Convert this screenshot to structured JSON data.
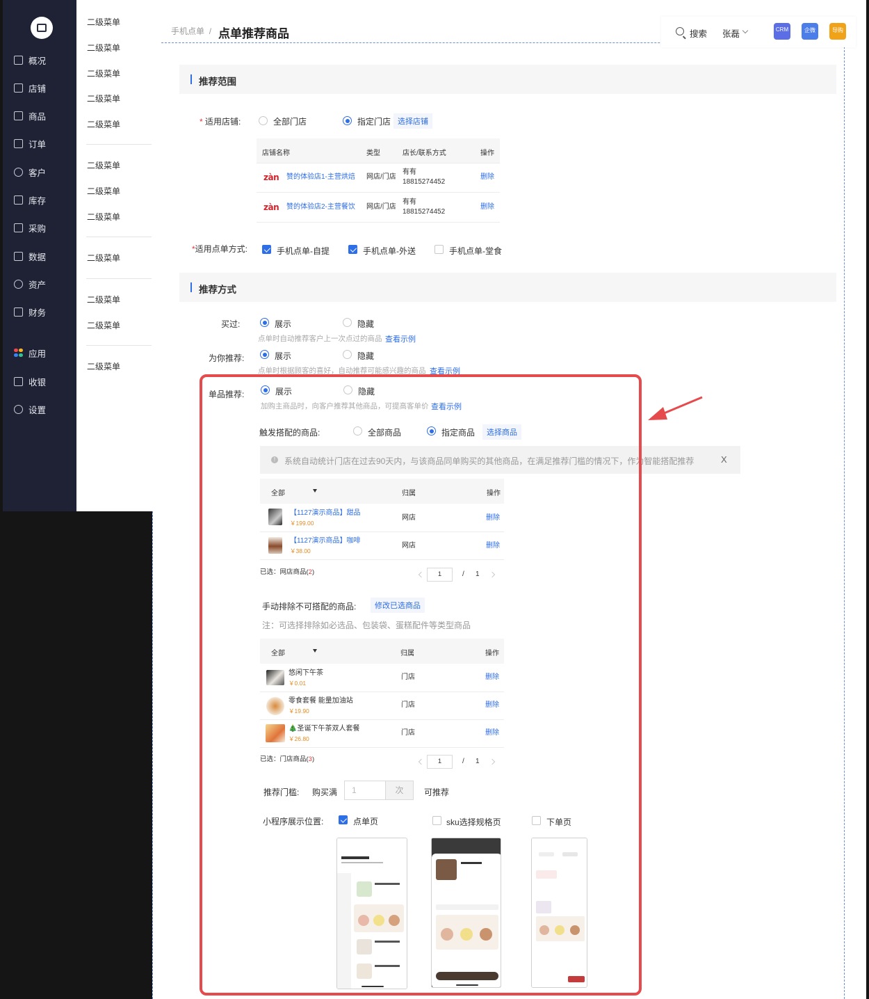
{
  "sidebar": {
    "items": [
      {
        "label": "概况",
        "icon": "overview-icon"
      },
      {
        "label": "店铺",
        "icon": "store-icon"
      },
      {
        "label": "商品",
        "icon": "product-bag-icon"
      },
      {
        "label": "订单",
        "icon": "order-icon"
      },
      {
        "label": "客户",
        "icon": "customer-icon"
      },
      {
        "label": "库存",
        "icon": "inventory-icon"
      },
      {
        "label": "采购",
        "icon": "purchase-icon"
      },
      {
        "label": "数据",
        "icon": "data-chart-icon"
      },
      {
        "label": "资产",
        "icon": "asset-icon"
      },
      {
        "label": "财务",
        "icon": "finance-icon"
      },
      {
        "label": "应用",
        "icon": "apps-icon"
      },
      {
        "label": "收银",
        "icon": "cashier-icon"
      },
      {
        "label": "设置",
        "icon": "settings-gear-icon"
      }
    ]
  },
  "submenu": {
    "items": [
      "二级菜单",
      "二级菜单",
      "二级菜单",
      "二级菜单",
      "二级菜单",
      "二级菜单",
      "二级菜单",
      "二级菜单",
      "二级菜单",
      "二级菜单",
      "二级菜单",
      "二级菜单"
    ]
  },
  "header": {
    "breadcrumb": "手机点单",
    "separator": "/",
    "title": "点单推荐商品",
    "search_label": "搜索",
    "user_name": "张磊",
    "badges": [
      {
        "label": "CRM",
        "color": "#5b6ee6"
      },
      {
        "label": "企微",
        "color": "#4b7ee8"
      },
      {
        "label": "导购",
        "color": "#f0a218"
      }
    ]
  },
  "scope": {
    "section_title": "推荐范围",
    "store_label": "适用店铺:",
    "required_mark": "*",
    "option_all": "全部门店",
    "option_specified": "指定门店",
    "select_store_link": "选择店铺",
    "selected_option": "指定门店",
    "table": {
      "headers": [
        "店铺名称",
        "类型",
        "店长/联系方式",
        "操作"
      ],
      "rows": [
        {
          "brand": "zàn",
          "name": "赞的体验店1-主营烘焙",
          "type": "网店/门店",
          "manager": "有有",
          "phone": "18815274452",
          "action": "删除"
        },
        {
          "brand": "zàn",
          "name": "赞的体验店2-主营餐饮",
          "type": "网店/门店",
          "manager": "有有",
          "phone": "18815274452",
          "action": "删除"
        }
      ]
    },
    "order_method_label": "适用点单方式:",
    "order_methods": [
      {
        "label": "手机点单-自提",
        "checked": true
      },
      {
        "label": "手机点单-外送",
        "checked": true
      },
      {
        "label": "手机点单-堂食",
        "checked": false
      }
    ]
  },
  "method": {
    "section_title": "推荐方式",
    "bought": {
      "label": "买过:",
      "show": "展示",
      "hide": "隐藏",
      "selected": "展示",
      "hint": "点单时自动推荐客户上一次点过的商品",
      "example_link": "查看示例"
    },
    "for_you": {
      "label": "为你推荐:",
      "show": "展示",
      "hide": "隐藏",
      "selected": "展示",
      "hint": "点单时根据顾客的喜好，自动推荐可能感兴趣的商品",
      "example_link": "查看示例"
    },
    "single": {
      "label": "单品推荐:",
      "show": "展示",
      "hide": "隐藏",
      "selected": "展示",
      "hint": "加购主商品时，向客户推荐其他商品，可提高客单价",
      "example_link": "查看示例"
    },
    "trigger": {
      "label": "触发搭配的商品:",
      "option_all": "全部商品",
      "option_specified": "指定商品",
      "selected": "指定商品",
      "select_link": "选择商品",
      "info": "系统自动统计门店在过去90天内，与该商品同单购买的其他商品，在满足推荐门槛的情况下，作为智能搭配推荐",
      "info_close": "X",
      "table": {
        "headers": [
          "全部",
          "归属",
          "操作"
        ],
        "rows": [
          {
            "name": "【1127演示商品】甜品",
            "price": "￥199.00",
            "belong": "网店",
            "action": "删除"
          },
          {
            "name": "【1127演示商品】咖啡",
            "price": "￥38.00",
            "belong": "网店",
            "action": "删除"
          }
        ]
      },
      "selected_summary_prefix": "已选：网店商品(",
      "selected_count": "2",
      "selected_summary_suffix": ")",
      "page": "1",
      "page_sep": "/",
      "page_total": "1"
    },
    "exclude": {
      "label": "手动排除不可搭配的商品:",
      "edit_link": "修改已选商品",
      "note": "注：可选择排除如必选品、包装袋、蛋糕配件等类型商品",
      "table": {
        "headers": [
          "全部",
          "归属",
          "操作"
        ],
        "rows": [
          {
            "name": "悠闲下午茶",
            "price": "￥0.01",
            "belong": "门店",
            "action": "删除"
          },
          {
            "name": "零食套餐 能量加油站",
            "price": "￥19.90",
            "belong": "门店",
            "action": "删除"
          },
          {
            "name": "🎄圣诞下午茶双人套餐",
            "price": "￥26.80",
            "belong": "门店",
            "action": "删除"
          }
        ]
      },
      "selected_summary_prefix": "已选：门店商品(",
      "selected_count": "3",
      "selected_summary_suffix": ")",
      "page": "1",
      "page_sep": "/",
      "page_total": "1"
    },
    "threshold": {
      "label": "推荐门槛:",
      "prefix": "购买满",
      "placeholder": "1",
      "suffix": "次",
      "after": "可推荐"
    },
    "position": {
      "label": "小程序展示位置:",
      "options": [
        {
          "label": "点单页",
          "checked": true
        },
        {
          "label": "sku选择规格页",
          "checked": false
        },
        {
          "label": "下单页",
          "checked": false
        }
      ]
    }
  },
  "colors": {
    "accent": "#2e6ee6",
    "highlight": "#e54a4c",
    "sidebar_bg": "#1f2235"
  }
}
